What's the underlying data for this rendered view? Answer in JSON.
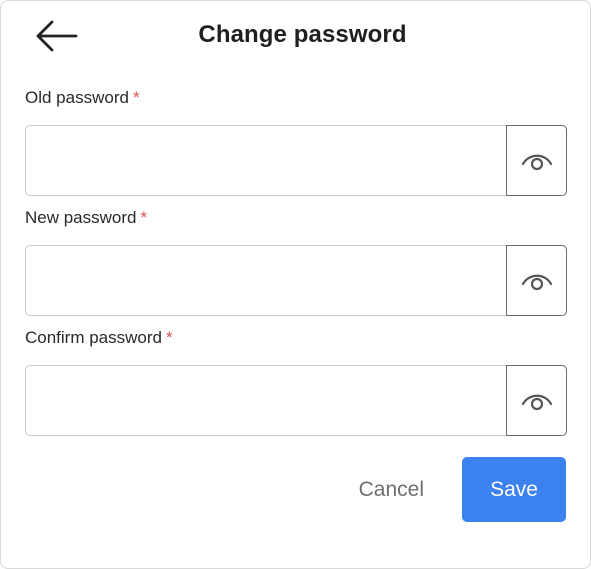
{
  "dialog": {
    "title": "Change password",
    "back_icon": "arrow-left-icon"
  },
  "fields": {
    "old_password": {
      "label": "Old password",
      "required_mark": "*",
      "value": "",
      "placeholder": "",
      "toggle_icon": "eye-icon"
    },
    "new_password": {
      "label": "New password",
      "required_mark": "*",
      "value": "",
      "placeholder": "",
      "toggle_icon": "eye-icon"
    },
    "confirm_password": {
      "label": "Confirm password",
      "required_mark": "*",
      "value": "",
      "placeholder": "",
      "toggle_icon": "eye-icon"
    }
  },
  "actions": {
    "cancel_label": "Cancel",
    "save_label": "Save"
  },
  "colors": {
    "accent": "#3b82f0",
    "required": "#d9534f",
    "border": "#c9c9c9",
    "muted_text": "#6f6f6f"
  }
}
